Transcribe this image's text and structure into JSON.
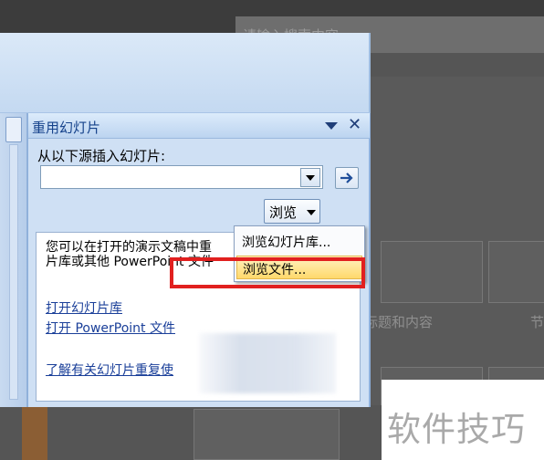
{
  "background": {
    "search_placeholder": "请输入搜索内容",
    "layout_label_1": "标题和内容",
    "layout_label_2": "节"
  },
  "task_pane": {
    "title": "重用幻灯片",
    "insert_label": "从以下源插入幻灯片:",
    "source_value": "",
    "browse_label": "浏览",
    "info_text": "您可以在打开的演示文稿中重\n片库或其他 PowerPoint 文件",
    "link_open_library": "打开幻灯片库",
    "link_open_ppt": "打开 PowerPoint 文件",
    "link_learn_more": "了解有关幻灯片重复使"
  },
  "browse_menu": {
    "items": [
      "浏览幻灯片库...",
      "浏览文件..."
    ]
  },
  "watermark": "软件技巧",
  "colors": {
    "highlight": "#e1201f",
    "title_text": "#15428b",
    "menu_selected": "#ffd96b"
  }
}
